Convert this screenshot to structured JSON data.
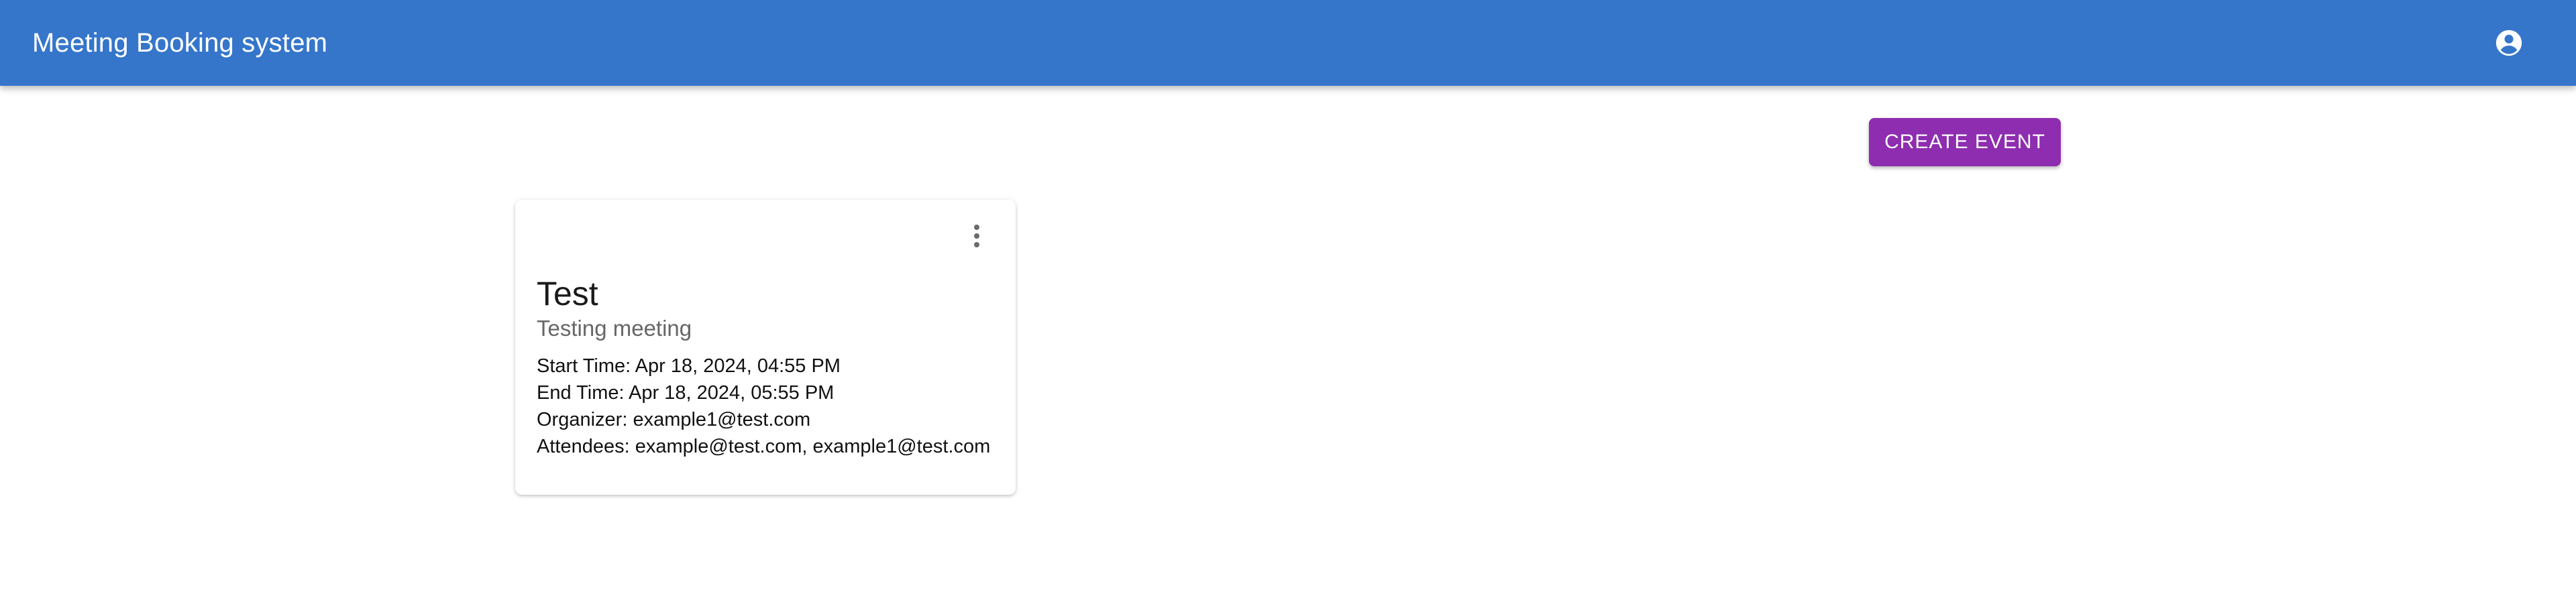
{
  "appbar": {
    "title": "Meeting Booking system",
    "account_icon": "account-circle-icon",
    "color": "#3576CB"
  },
  "toolbar": {
    "create_label": "CREATE EVENT",
    "create_color": "#8E2DB0"
  },
  "events": [
    {
      "title": "Test",
      "subtitle": "Testing meeting",
      "menu_icon": "more-vert-icon",
      "details": [
        "Start Time: Apr 18, 2024, 04:55 PM",
        "End Time: Apr 18, 2024, 05:55 PM",
        "Organizer: example1@test.com",
        "Attendees: example@test.com, example1@test.com"
      ]
    }
  ]
}
